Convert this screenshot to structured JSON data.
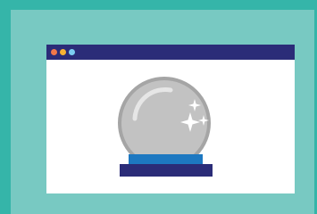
{
  "colors": {
    "outer_border": "#35b5a9",
    "inner_panel": "#78c9c2",
    "window_bg": "#ffffff",
    "titlebar": "#2b2c78",
    "dot_close": "#f3784a",
    "dot_minimize": "#f9b233",
    "dot_maximize": "#7ccef2",
    "ball_fill": "#c2c2c2",
    "ball_stroke": "#a5a5a5",
    "ball_highlight": "#e6e6e6",
    "sparkle": "#ffffff",
    "stand_top": "#1d78c1",
    "stand_base": "#2b2c78"
  },
  "window": {
    "traffic_lights": [
      "close",
      "minimize",
      "maximize"
    ]
  },
  "illustration": {
    "icon": "crystal-ball-icon"
  }
}
